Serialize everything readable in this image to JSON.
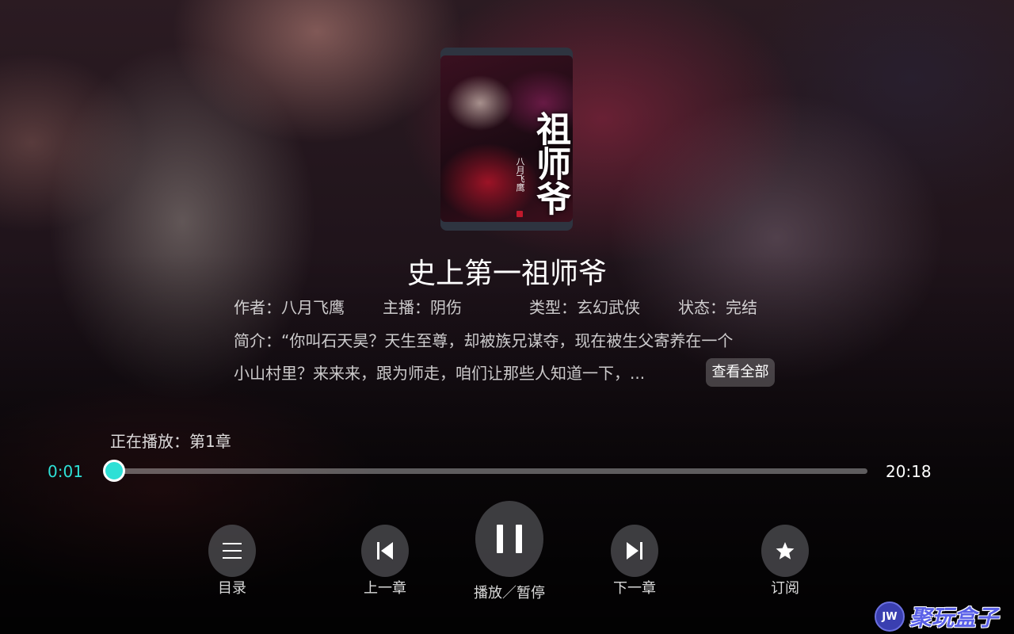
{
  "book": {
    "cover_title": "祖师爷",
    "cover_subtitle": "八月飞鹰",
    "title": "史上第一祖师爷",
    "author": "作者：八月飞鹰",
    "narrator": "主播：阴伤",
    "genre": "类型：玄幻武侠",
    "status": "状态：完结",
    "intro_line1": "简介：“你叫石天昊？天生至尊，却被族兄谋夺，现在被生父寄养在一个",
    "intro_line2": "小山村里？来来来，跟为师走，咱们让那些人知道一下，...",
    "more_label": "查看全部"
  },
  "player": {
    "now_playing": "正在播放：第1章",
    "current_time": "0:01",
    "total_time": "20:18",
    "progress_fraction": 0.001,
    "accent_color": "#2ee0d6"
  },
  "controls": {
    "toc_label": "目录",
    "prev_label": "上一章",
    "play_pause_label": "播放／暂停",
    "next_label": "下一章",
    "subscribe_label": "订阅"
  },
  "brand": {
    "badge": "JW",
    "name": "聚玩盒子"
  }
}
